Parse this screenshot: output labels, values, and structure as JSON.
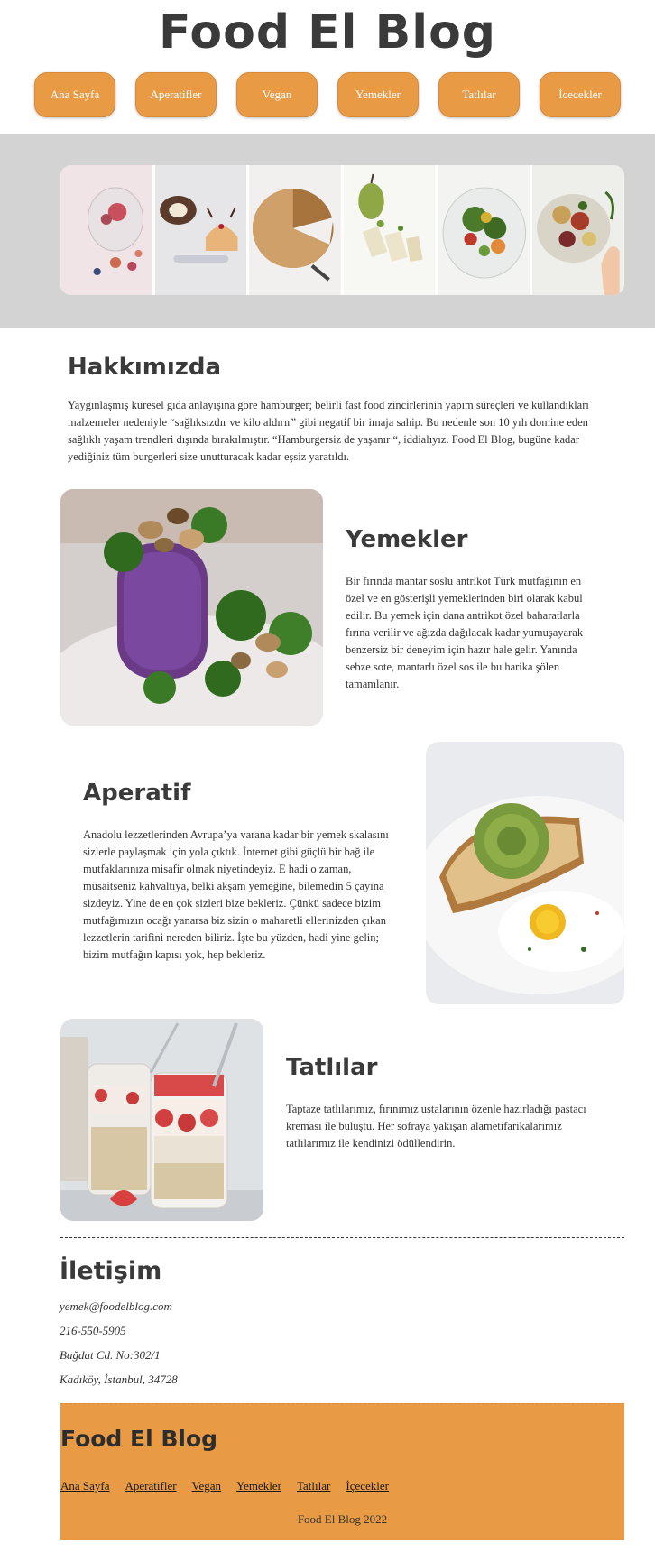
{
  "header": {
    "title": "Food El Blog",
    "nav": [
      "Ana Sayfa",
      "Aperatifler",
      "Vegan",
      "Yemekler",
      "Tatlılar",
      "İcecekler"
    ]
  },
  "about": {
    "heading": "Hakkımızda",
    "text": "Yaygınlaşmış küresel gıda anlayışına göre hamburger; belirli fast food zincirlerinin yapım süreçleri ve kullandıkları malzemeler nedeniyle “sağlıksızdır ve kilo aldırır” gibi negatif bir imaja sahip. Bu nedenle son 10 yılı domine eden sağlıklı yaşam trendleri dışında bırakılmıştır. “Hamburgersiz de yaşanır “, iddialıyız. Food El Blog, bugüne kadar yediğiniz tüm burgerleri size unutturacak kadar eşsiz yaratıldı."
  },
  "sections": {
    "yemekler": {
      "heading": "Yemekler",
      "text": "Bir fırında mantar soslu antrikot Türk mutfağının en özel ve en gösterişli yemeklerinden biri olarak kabul edilir. Bu yemek için dana antrikot özel baharatlarla fırına verilir ve ağızda dağılacak kadar yumuşayarak benzersiz bir deneyim için hazır hale gelir. Yanında sebze sote, mantarlı özel sos ile bu harika şölen tamamlanır."
    },
    "aperatif": {
      "heading": "Aperatif",
      "text": "Anadolu lezzetlerinden Avrupa’ya varana kadar bir yemek skalasını sizlerle paylaşmak için yola çıktık. İnternet gibi güçlü bir bağ ile mutfaklarınıza misafir olmak niyetindeyiz. E hadi o zaman, müsaitseniz kahvaltıya, belki akşam yemeğine, bilemedin 5 çayına sizdeyiz. Yine de en çok sizleri bize bekleriz. Çünkü sadece bizim mutfağımızın ocağı yanarsa biz sizin o maharetli ellerinizden çıkan lezzetlerin tarifini nereden biliriz. İşte bu yüzden, hadi yine gelin; bizim mutfağın kapısı yok, hep bekleriz."
    },
    "tatlilar": {
      "heading": "Tatlılar",
      "text": "Taptaze tatlılarımız, fırınımız ustalarının özenle hazırladığı pastacı kreması ile buluştu. Her sofraya yakışan alametifarikalarımız tatlılarımız ile kendinizi ödüllendirin."
    }
  },
  "contact": {
    "heading": "İletişim",
    "email": "yemek@foodelblog.com",
    "phone": "216-550-5905",
    "address1": "Bağdat Cd. No:302/1",
    "address2": "Kadıköy, İstanbul, 34728"
  },
  "footer": {
    "title": "Food El Blog",
    "links": [
      "Ana Sayfa",
      "Aperatifler",
      "Vegan",
      "Yemekler",
      "Tatlılar",
      "İçecekler"
    ],
    "copyright": "Food El Blog 2022"
  },
  "colors": {
    "accent": "#e89a45",
    "band": "#d3d3d3",
    "text": "#333333"
  }
}
